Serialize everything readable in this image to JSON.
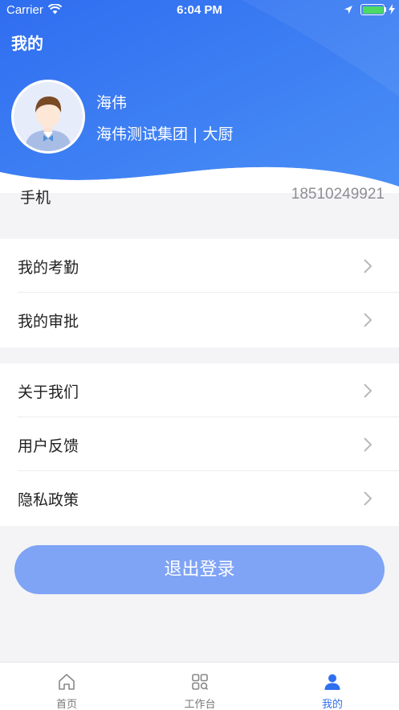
{
  "status_bar": {
    "carrier": "Carrier",
    "time": "6:04 PM",
    "battery_level": 1.0
  },
  "header": {
    "title": "我的",
    "gradient_colors": [
      "#2f6df0",
      "#4a90f5"
    ]
  },
  "profile": {
    "name": "海伟",
    "organization": "海伟测试集团 | 大厨"
  },
  "phone": {
    "label": "手机",
    "value": "18510249921"
  },
  "menu_group_1": [
    {
      "label": "我的考勤",
      "icon": "chevron-right-icon"
    },
    {
      "label": "我的审批",
      "icon": "chevron-right-icon"
    }
  ],
  "menu_group_2": [
    {
      "label": "关于我们",
      "icon": "chevron-right-icon"
    },
    {
      "label": "用户反馈",
      "icon": "chevron-right-icon"
    },
    {
      "label": "隐私政策",
      "icon": "chevron-right-icon"
    }
  ],
  "logout": {
    "label": "退出登录",
    "color": "#7fa3f5"
  },
  "tabbar": {
    "tabs": [
      {
        "label": "首页",
        "icon": "home-icon",
        "active": false
      },
      {
        "label": "工作台",
        "icon": "workbench-icon",
        "active": false
      },
      {
        "label": "我的",
        "icon": "person-icon",
        "active": true
      }
    ],
    "active_color": "#2f6ff0"
  }
}
